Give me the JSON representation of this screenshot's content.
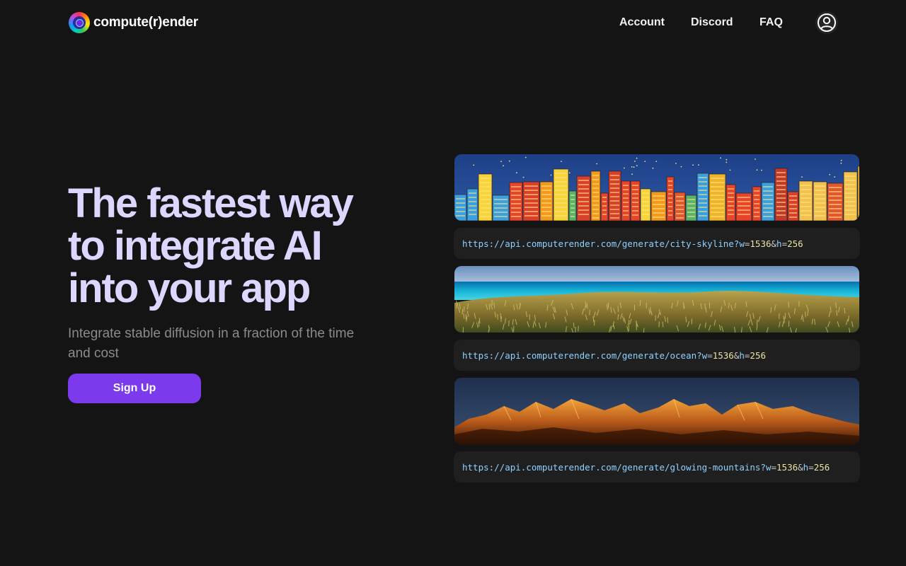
{
  "brand": {
    "name": "compute(r)ender"
  },
  "nav": {
    "account": "Account",
    "discord": "Discord",
    "faq": "FAQ"
  },
  "hero": {
    "title_lines": [
      "The fastest way",
      "to integrate AI",
      "into your app"
    ],
    "subtitle": "Integrate stable diffusion in a fraction of the time and cost",
    "cta": "Sign Up"
  },
  "examples": [
    {
      "image": "city-skyline-image",
      "base": "https://api.computerender.com/generate/city-skyline?",
      "w_key": "w",
      "w_val": "1536",
      "h_key": "h",
      "h_val": "256"
    },
    {
      "image": "ocean-image",
      "base": "https://api.computerender.com/generate/ocean?",
      "w_key": "w",
      "w_val": "1536",
      "h_key": "h",
      "h_val": "256"
    },
    {
      "image": "glowing-mountains-image",
      "base": "https://api.computerender.com/generate/glowing-mountains?",
      "w_key": "w",
      "w_val": "1536",
      "h_key": "h",
      "h_val": "256"
    }
  ],
  "colors": {
    "background": "#141414",
    "accent": "#7c3aed",
    "title": "#ddd6fe",
    "url": "#8fd0ff",
    "number": "#e9e3a6"
  },
  "icons": {
    "user": "user-circle-icon",
    "logo": "logo-icon"
  }
}
